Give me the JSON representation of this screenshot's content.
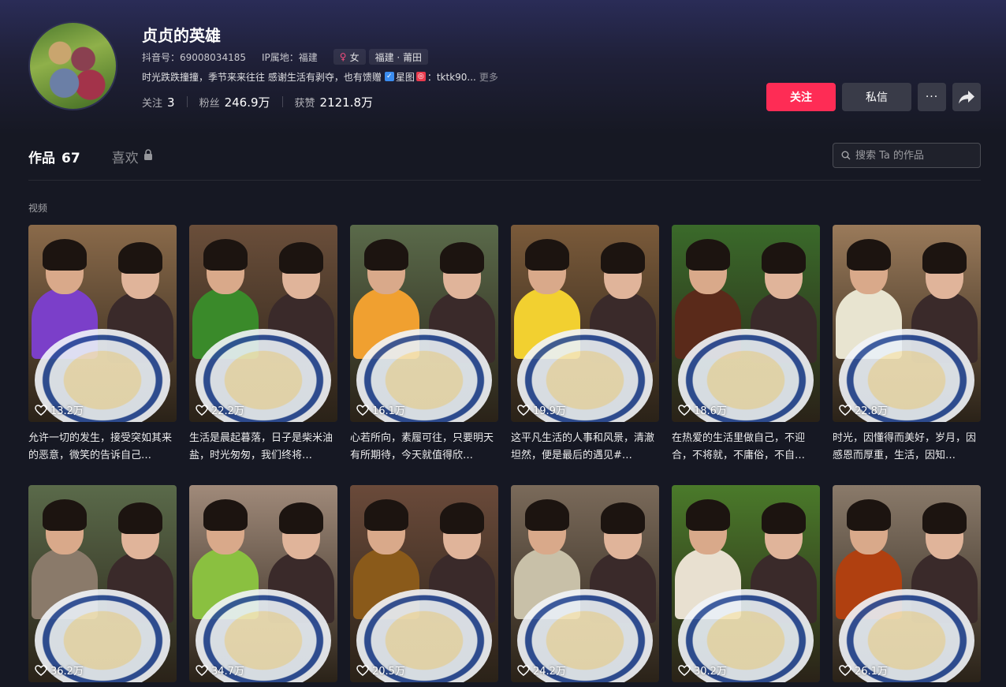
{
  "profile": {
    "name": "贞贞的英雄",
    "douyin_id": "抖音号：69008034185",
    "ip_location": "IP属地：福建",
    "gender_tag": "女",
    "region_tag": "福建 · 莆田",
    "bio_text": "时光跌跌撞撞，季节来来往往 感谢生活有剥夺，也有馈赠",
    "bio_star_label": "星图",
    "bio_tail": "：tktk90...",
    "bio_more": "更多",
    "stats": {
      "following_label": "关注",
      "following_value": "3",
      "followers_label": "粉丝",
      "followers_value": "246.9万",
      "likes_label": "获赞",
      "likes_value": "2121.8万"
    }
  },
  "actions": {
    "follow_label": "关注",
    "message_label": "私信",
    "more_label": "···"
  },
  "tabs": {
    "works_label": "作品",
    "works_count": "67",
    "likes_label": "喜欢"
  },
  "search": {
    "placeholder": "搜索 Ta 的作品"
  },
  "section_label": "视频",
  "videos": [
    {
      "likes": "13.2万",
      "title": "允许一切的发生，接受突如其来的恶意，微笑的告诉自己…",
      "bg": "#8a6a4a",
      "accent": "#7b3fc9"
    },
    {
      "likes": "22.2万",
      "title": "生活是晨起暮落，日子是柴米油盐，时光匆匆，我们终将…",
      "bg": "#6a4e3a",
      "accent": "#3a8a2a"
    },
    {
      "likes": "16.1万",
      "title": "心若所向，素履可往，只要明天有所期待，今天就值得欣…",
      "bg": "#5a6a4a",
      "accent": "#f0a030"
    },
    {
      "likes": "19.9万",
      "title": "这平凡生活的人事和风景，清澈坦然，便是最后的遇见#…",
      "bg": "#7a5a3a",
      "accent": "#f2d030"
    },
    {
      "likes": "18.6万",
      "title": "在热爱的生活里做自己，不迎合，不将就，不庸俗，不自…",
      "bg": "#3a6a2a",
      "accent": "#5a2a1a"
    },
    {
      "likes": "22.8万",
      "title": "时光，因懂得而美好，岁月，因感恩而厚重，生活，因知…",
      "bg": "#9a7a5a",
      "accent": "#e8e4d0"
    },
    {
      "likes": "36.2万",
      "title": "",
      "bg": "#5a6a4a",
      "accent": "#8a7a6a"
    },
    {
      "likes": "34.7万",
      "title": "",
      "bg": "#a08a7a",
      "accent": "#8ac040"
    },
    {
      "likes": "20.5万",
      "title": "",
      "bg": "#6a4a3a",
      "accent": "#8a5a1a"
    },
    {
      "likes": "24.2万",
      "title": "",
      "bg": "#7a6a5a",
      "accent": "#c8c0a8"
    },
    {
      "likes": "30.2万",
      "title": "",
      "bg": "#4a7a2a",
      "accent": "#e8e0d0"
    },
    {
      "likes": "26.1万",
      "title": "",
      "bg": "#8a7a6a",
      "accent": "#b04010"
    }
  ]
}
